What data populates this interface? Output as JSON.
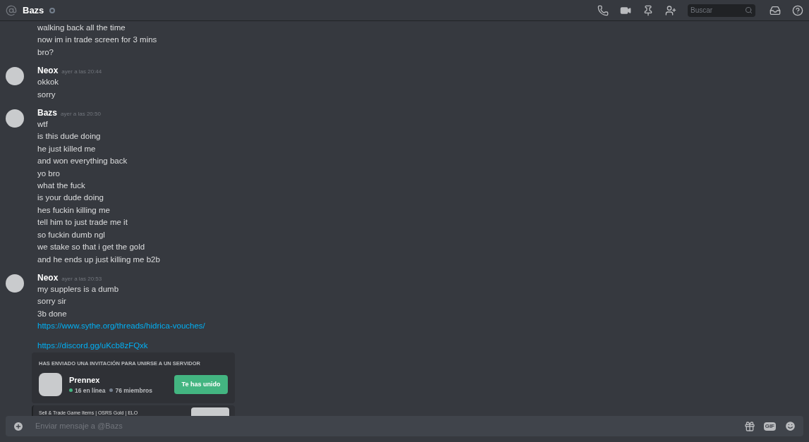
{
  "header": {
    "title": "Bazs",
    "search": {
      "placeholder": "Buscar"
    }
  },
  "messages": [
    {
      "lines": [
        {
          "text": "walking back all the time"
        },
        {
          "text": "now im in trade screen for 3 mins"
        },
        {
          "text": "bro?"
        }
      ]
    },
    {
      "author": "Neox",
      "time": "ayer a las 20:44",
      "lines": [
        {
          "text": "okkok"
        },
        {
          "text": "sorry"
        }
      ]
    },
    {
      "author": "Bazs",
      "time": "ayer a las 20:50",
      "lines": [
        {
          "text": "wtf"
        },
        {
          "text": "is this dude doing"
        },
        {
          "text": "he just killed me"
        },
        {
          "text": "and won everything back"
        },
        {
          "text": "yo bro"
        },
        {
          "text": "what the fuck"
        },
        {
          "text": "is your dude doing"
        },
        {
          "text": "hes fuckin killing me"
        },
        {
          "text": "tell him to just trade me it"
        },
        {
          "text": "so fuckin dumb ngl"
        },
        {
          "text": "we stake so that i get the gold"
        },
        {
          "text": "and he ends up just killing me b2b"
        }
      ]
    },
    {
      "author": "Neox",
      "time": "ayer a las 20:53",
      "lines": [
        {
          "text": "my supplers is a dumb"
        },
        {
          "text": "sorry sir"
        },
        {
          "text": "3b done"
        },
        {
          "text": "https://www.sythe.org/threads/hidrica-vouches/",
          "kind": "link"
        },
        {
          "text": "https://discord.gg/uKcb8zFQxk",
          "kind": "link",
          "gap": true
        }
      ]
    }
  ],
  "invite": {
    "heading": "HAS ENVIADO UNA INVITACIÓN PARA UNIRSE A UN SERVIDOR",
    "server": "Prennex",
    "stats": [
      {
        "text": "16 en línea",
        "color": "#43b581"
      },
      {
        "text": "76 miembros",
        "color": "#747f8d"
      }
    ],
    "button": "Te has unido"
  },
  "embed": {
    "title": "Sell & Trade Game Items | OSRS Gold | ELO"
  },
  "composer": {
    "placeholder": "Enviar mensaje a @Bazs",
    "gif": "GIF"
  }
}
